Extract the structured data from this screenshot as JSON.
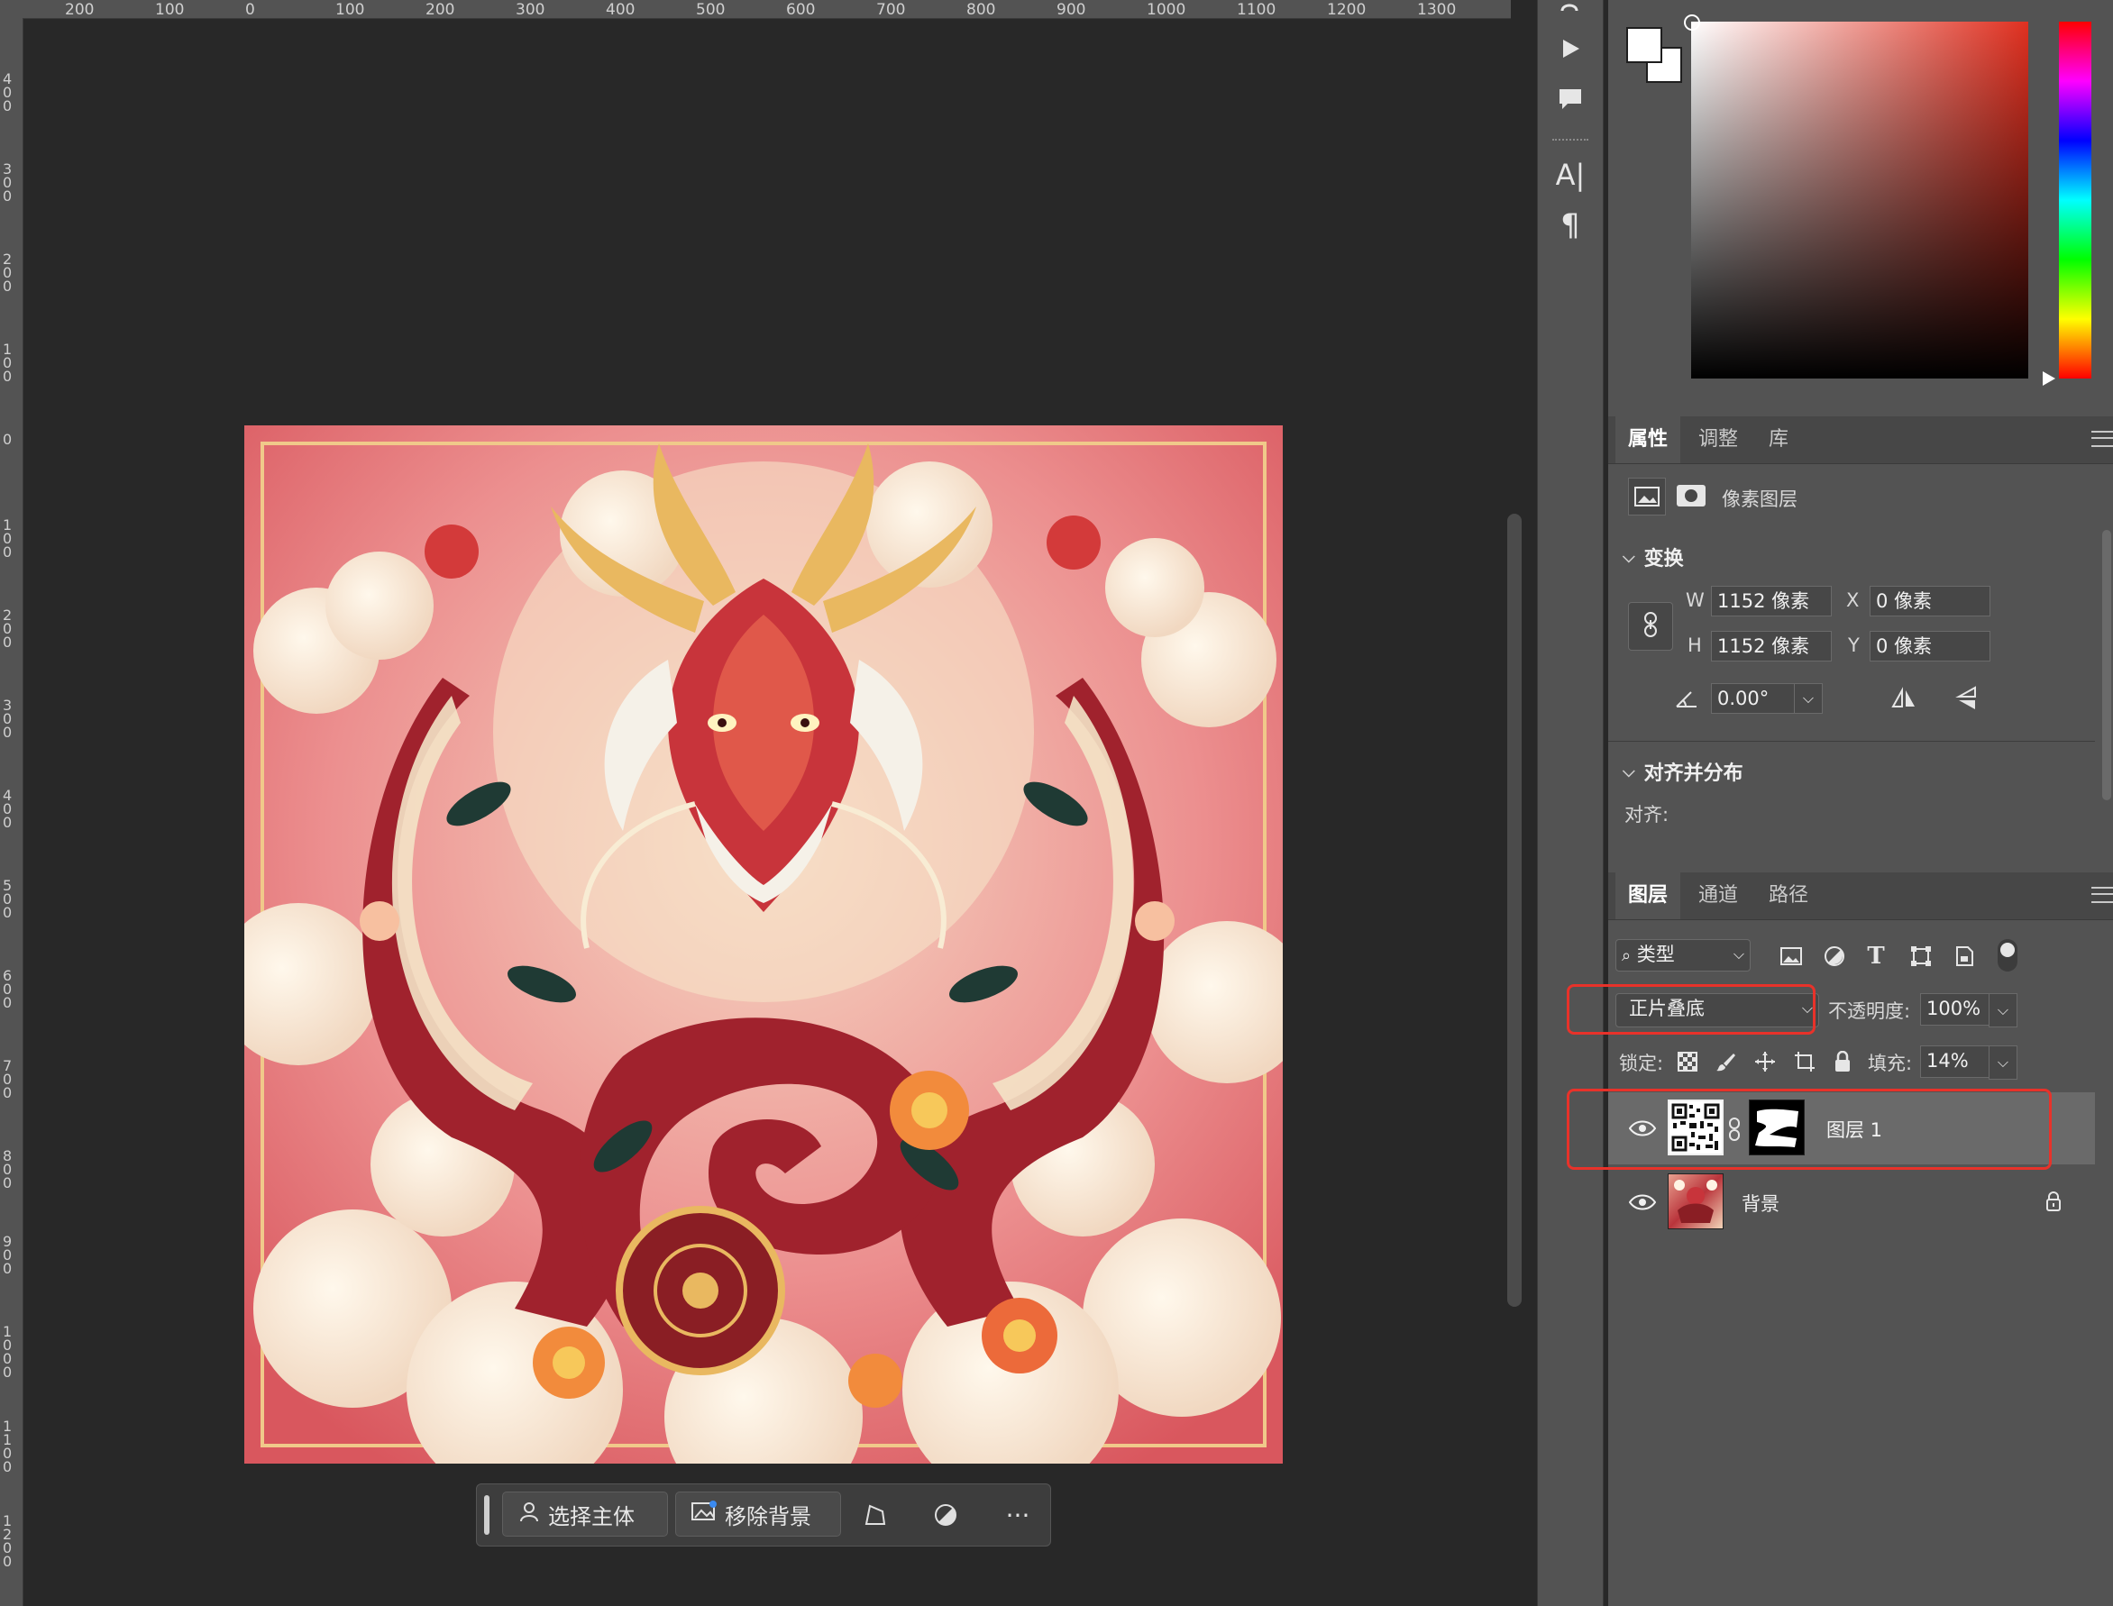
{
  "ruler": {
    "top_labels": [
      "200",
      "100",
      "0",
      "100",
      "200",
      "300",
      "400",
      "500",
      "600",
      "700",
      "800",
      "900",
      "1000",
      "1100",
      "1200",
      "1300"
    ],
    "left_labels": [
      "400",
      "300",
      "200",
      "100",
      "0",
      "100",
      "200",
      "300",
      "400",
      "500",
      "600",
      "700",
      "800",
      "900",
      "1000",
      "1100",
      "1200"
    ]
  },
  "context_bar": {
    "select_subject": "选择主体",
    "remove_background": "移除背景",
    "icons": [
      "select-subject-icon",
      "remove-background-icon",
      "transform-icon",
      "adjust-icon",
      "more-icon"
    ],
    "more_glyph": "···"
  },
  "tools": {
    "icons": [
      "history-icon",
      "play-icon",
      "comment-icon",
      "character-icon",
      "paragraph-icon"
    ],
    "character_glyph": "A|",
    "paragraph_glyph": "¶"
  },
  "color": {
    "foreground": "#ffffff",
    "background": "#ffffff",
    "hue_base": "#e03020"
  },
  "properties_panel": {
    "tabs": [
      "属性",
      "调整",
      "库"
    ],
    "active_tab": "属性",
    "layer_type": "像素图层",
    "transform": {
      "title": "变换",
      "w_label": "W",
      "w_value": "1152 像素",
      "h_label": "H",
      "h_value": "1152 像素",
      "x_label": "X",
      "x_value": "0 像素",
      "y_label": "Y",
      "y_value": "0 像素",
      "angle_value": "0.00°"
    },
    "align": {
      "title": "对齐并分布",
      "label": "对齐:"
    }
  },
  "layers_panel": {
    "tabs": [
      "图层",
      "通道",
      "路径"
    ],
    "active_tab": "图层",
    "filter_kind": "类型",
    "filter_icons": [
      "image-filter-icon",
      "adjustment-filter-icon",
      "type-filter-icon",
      "shape-filter-icon",
      "smart-object-filter-icon",
      "filter-toggle-icon"
    ],
    "blend_mode": "正片叠底",
    "opacity_label": "不透明度:",
    "opacity_value": "100%",
    "lock_label": "锁定:",
    "lock_icons": [
      "lock-transparent-icon",
      "lock-paint-icon",
      "lock-position-icon",
      "lock-artboard-icon",
      "lock-all-icon"
    ],
    "fill_label": "填充:",
    "fill_value": "14%",
    "layers": [
      {
        "name": "图层 1",
        "visible": true,
        "selected": true,
        "has_mask": true,
        "locked": false
      },
      {
        "name": "背景",
        "visible": true,
        "selected": false,
        "has_mask": false,
        "locked": true
      }
    ],
    "highlight_color": "#e8322a"
  }
}
